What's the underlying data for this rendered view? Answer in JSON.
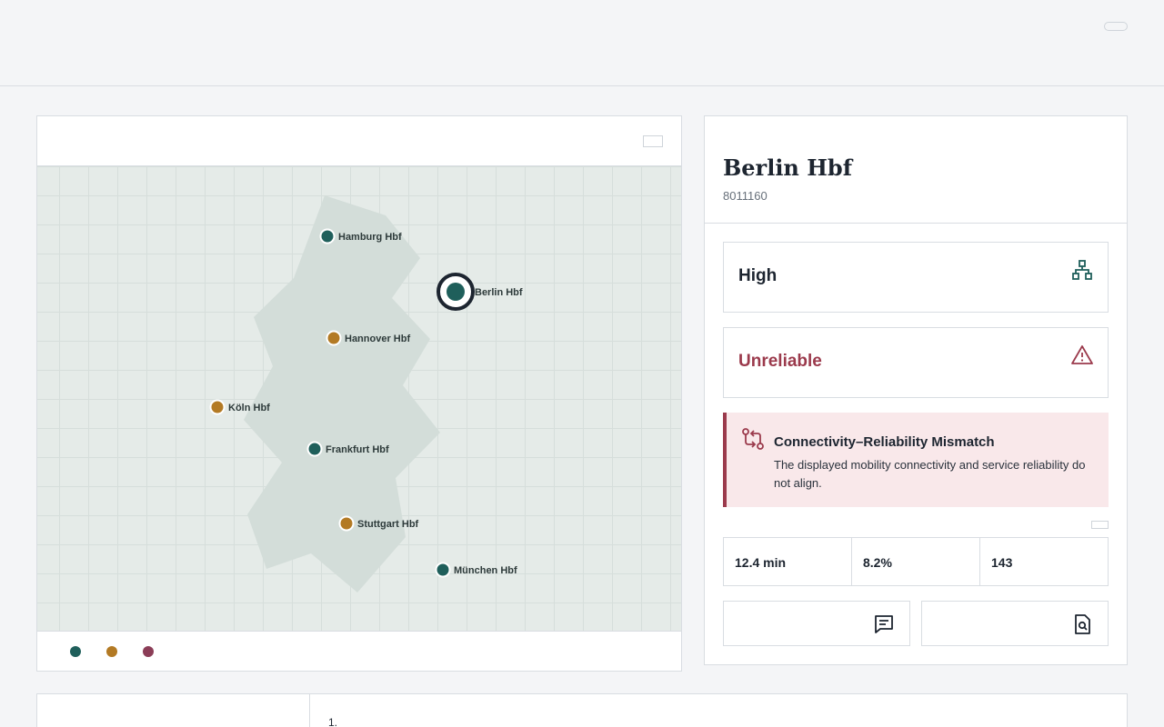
{
  "colors": {
    "accent_teal": "#1f5f5b",
    "accent_ochre": "#b37a24",
    "accent_plum": "#8b3d57",
    "danger": "#9b3a4c"
  },
  "map": {
    "stations": [
      {
        "name": "Hamburg Hbf",
        "category": "teal"
      },
      {
        "name": "Berlin Hbf",
        "category": "teal",
        "selected": true
      },
      {
        "name": "Hannover Hbf",
        "category": "ochre"
      },
      {
        "name": "Köln Hbf",
        "category": "ochre"
      },
      {
        "name": "Frankfurt Hbf",
        "category": "teal"
      },
      {
        "name": "Stuttgart Hbf",
        "category": "ochre"
      },
      {
        "name": "München Hbf",
        "category": "teal"
      }
    ],
    "legend": [
      "teal",
      "ochre",
      "plum"
    ]
  },
  "detail": {
    "title": "Berlin Hbf",
    "station_id": "8011160",
    "connectivity": {
      "label": "High",
      "icon": "network-icon"
    },
    "reliability": {
      "label": "Unreliable",
      "icon": "warning-icon"
    },
    "alert": {
      "icon": "compare-arrows-icon",
      "title": "Connectivity–Reliability Mismatch",
      "text": "The displayed mobility connectivity and service reliability do not align."
    },
    "metrics": [
      "12.4 min",
      "8.2%",
      "143"
    ],
    "actions": [
      {
        "icon": "message-icon"
      },
      {
        "icon": "document-search-icon"
      }
    ]
  },
  "bottom": {
    "first_item": "1."
  }
}
